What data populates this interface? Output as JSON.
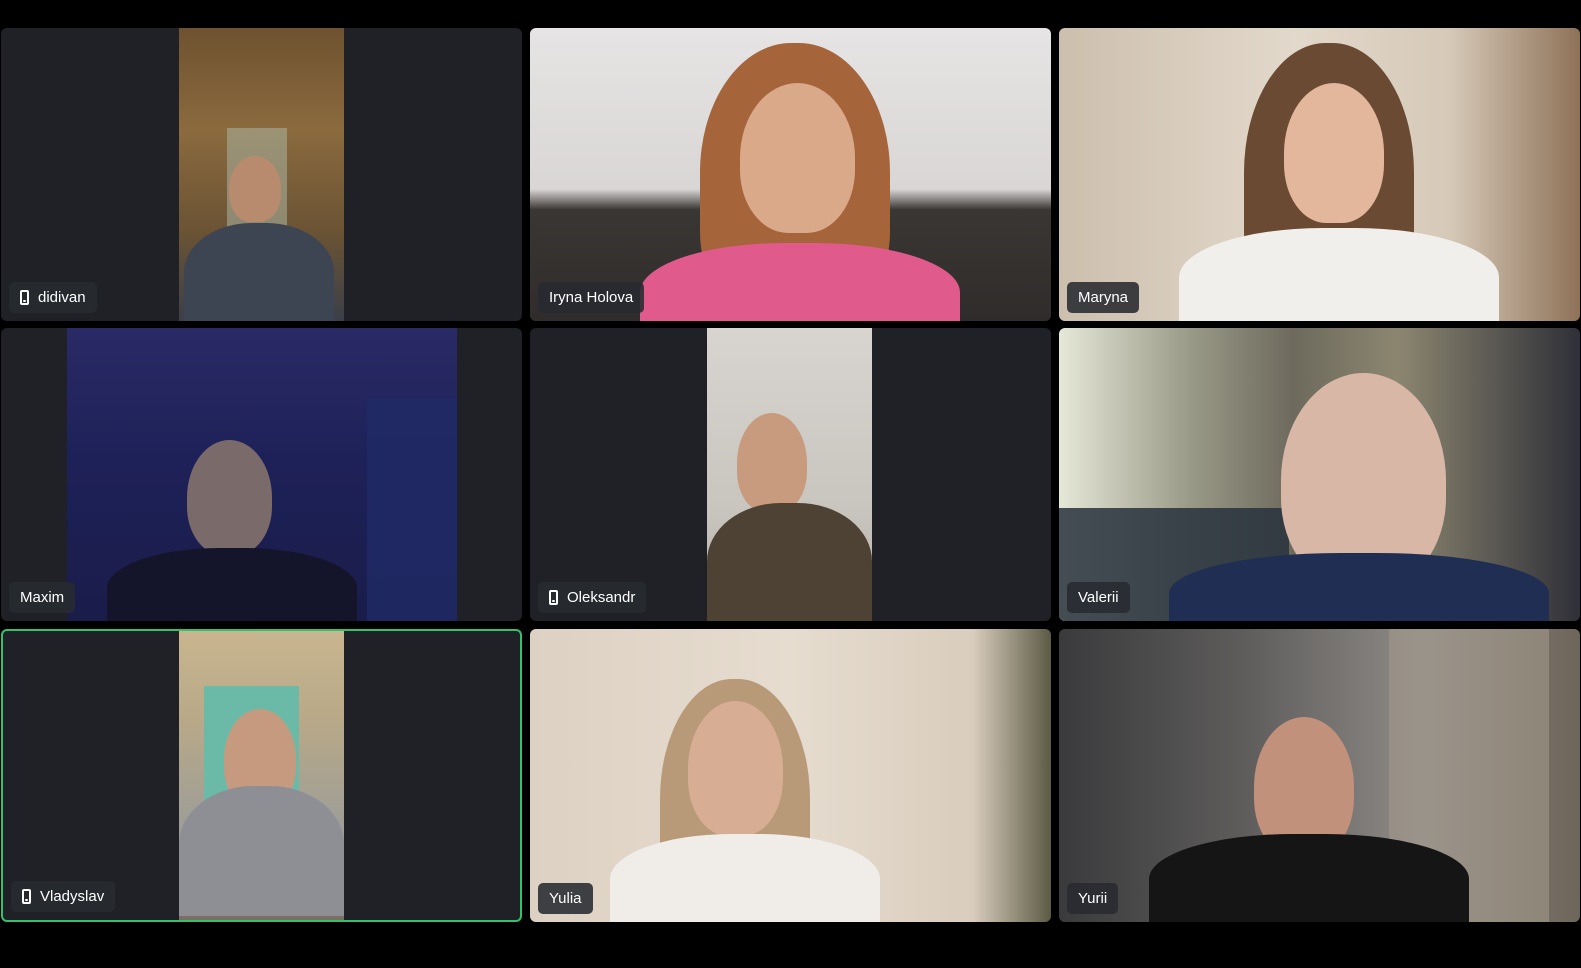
{
  "meeting": {
    "participants": [
      {
        "name": "didivan",
        "device": "phone-icon",
        "speaking": false
      },
      {
        "name": "Iryna Holova",
        "device": "",
        "speaking": false
      },
      {
        "name": "Maryna",
        "device": "",
        "speaking": false
      },
      {
        "name": "Maxim",
        "device": "",
        "speaking": false
      },
      {
        "name": "Oleksandr",
        "device": "phone-icon",
        "speaking": false
      },
      {
        "name": "Valerii",
        "device": "",
        "speaking": false
      },
      {
        "name": "Vladyslav",
        "device": "phone-icon",
        "speaking": true
      },
      {
        "name": "Yulia",
        "device": "",
        "speaking": false
      },
      {
        "name": "Yurii",
        "device": "",
        "speaking": false
      }
    ]
  },
  "colors": {
    "background": "#000000",
    "tile_background": "#1f2126",
    "active_speaker_border": "#2fc46a",
    "name_tag_background": "#282a30",
    "name_tag_text": "#ffffff"
  }
}
